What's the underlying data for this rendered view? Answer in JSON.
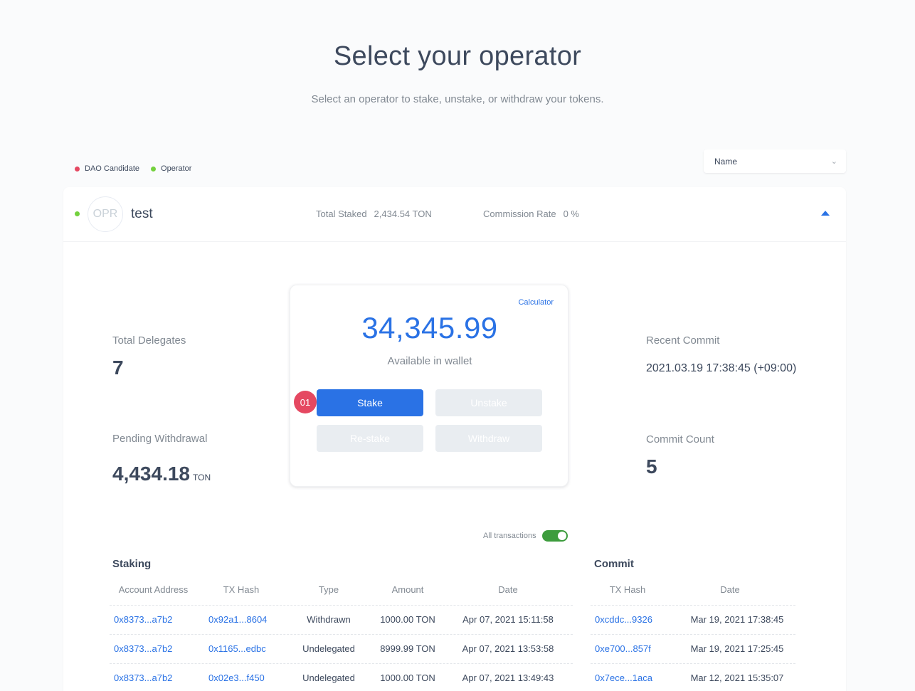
{
  "header": {
    "title": "Select your operator",
    "subtitle": "Select an operator to stake, unstake, or withdraw your tokens."
  },
  "legend": [
    {
      "label": "DAO Candidate",
      "color": "#e54861"
    },
    {
      "label": "Operator",
      "color": "#73d13d"
    }
  ],
  "sort": {
    "selected": "Name"
  },
  "operator": {
    "avatar_text": "OPR",
    "name": "test",
    "total_staked_label": "Total Staked",
    "total_staked_value": "2,434.54 TON",
    "commission_label": "Commission Rate",
    "commission_value": "0 %"
  },
  "metrics": {
    "total_delegates_label": "Total Delegates",
    "total_delegates_value": "7",
    "pending_withdrawal_label": "Pending Withdrawal",
    "pending_withdrawal_value": "4,434.18",
    "pending_withdrawal_unit": "TON",
    "recent_commit_label": "Recent Commit",
    "recent_commit_value": "2021.03.19 17:38:45 (+09:00)",
    "commit_count_label": "Commit Count",
    "commit_count_value": "5"
  },
  "wallet": {
    "calculator_label": "Calculator",
    "balance": "34,345.99",
    "balance_label": "Available in wallet",
    "step_badge": "01",
    "buttons": {
      "stake": "Stake",
      "unstake": "Unstake",
      "restake": "Re-stake",
      "withdraw": "Withdraw"
    }
  },
  "toggle": {
    "label": "All transactions",
    "on": true
  },
  "staking": {
    "title": "Staking",
    "columns": [
      "Account Address",
      "TX Hash",
      "Type",
      "Amount",
      "Date"
    ],
    "rows": [
      [
        "0x8373...a7b2",
        "0x92a1...8604",
        "Withdrawn",
        "1000.00 TON",
        "Apr 07, 2021 15:11:58"
      ],
      [
        "0x8373...a7b2",
        "0x1165...edbc",
        "Undelegated",
        "8999.99 TON",
        "Apr 07, 2021 13:53:58"
      ],
      [
        "0x8373...a7b2",
        "0x02e3...f450",
        "Undelegated",
        "1000.00 TON",
        "Apr 07, 2021 13:49:43"
      ]
    ]
  },
  "commit": {
    "title": "Commit",
    "columns": [
      "TX Hash",
      "Date"
    ],
    "rows": [
      [
        "0xcddc...9326",
        "Mar 19, 2021 17:38:45"
      ],
      [
        "0xe700...857f",
        "Mar 19, 2021 17:25:45"
      ],
      [
        "0x7ece...1aca",
        "Mar 12, 2021 15:35:07"
      ]
    ]
  }
}
